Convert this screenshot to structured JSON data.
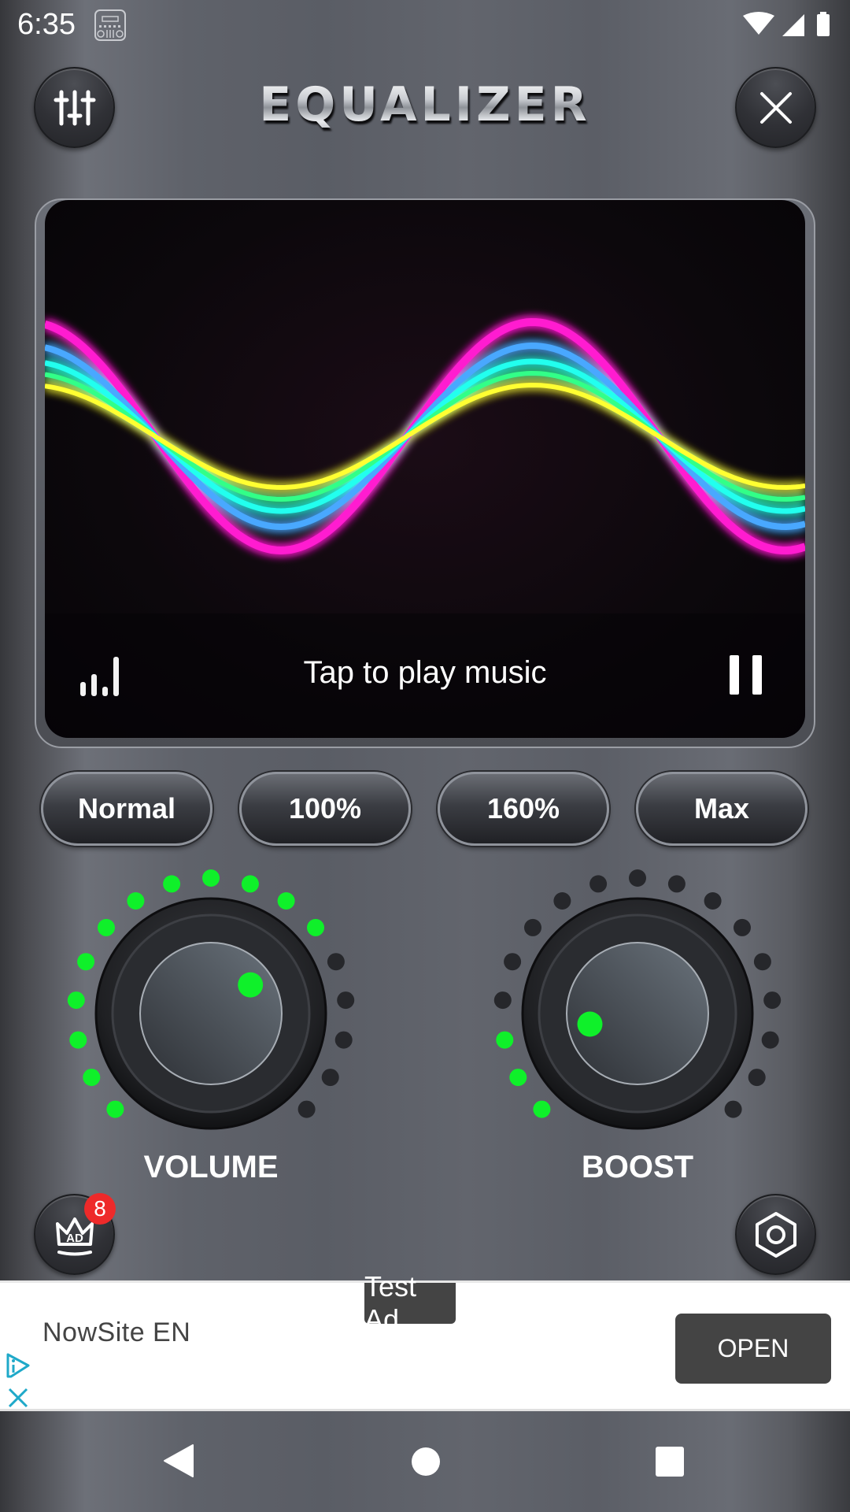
{
  "status_bar": {
    "time": "6:35",
    "app_icon": "dj-mixer-icon",
    "icons": [
      "wifi-icon",
      "cell-signal-icon",
      "battery-icon"
    ]
  },
  "header": {
    "title": "EQUALIZER",
    "left_button_icon": "equalizer-sliders-icon",
    "right_button_icon": "close-icon"
  },
  "visualizer": {
    "caption": "Tap to play music",
    "left_icon": "signal-bars-icon",
    "right_icon": "pause-icon",
    "wave_colors": [
      "#ff1fd0",
      "#4aa8ff",
      "#22ffee",
      "#33ff88",
      "#ffff33"
    ]
  },
  "presets": [
    {
      "label": "Normal"
    },
    {
      "label": "100%"
    },
    {
      "label": "160%"
    },
    {
      "label": "Max"
    }
  ],
  "knobs": [
    {
      "label": "VOLUME",
      "total_steps": 17,
      "active_steps": 12,
      "level": 0.7
    },
    {
      "label": "BOOST",
      "total_steps": 17,
      "active_steps": 3,
      "level": 0.12
    }
  ],
  "colors": {
    "led_on": "#0ff02a",
    "led_off": "#26272b",
    "badge": "#ee2a2a"
  },
  "footer": {
    "remove_ads_icon": "crown-ad-icon",
    "remove_ads_badge": "8",
    "settings_icon": "hexagon-settings-icon"
  },
  "ad": {
    "test_label": "Test Ad",
    "title": "NowSite EN",
    "cta": "OPEN"
  },
  "nav": {
    "back": "back-icon",
    "home": "home-icon",
    "recents": "recents-icon"
  }
}
